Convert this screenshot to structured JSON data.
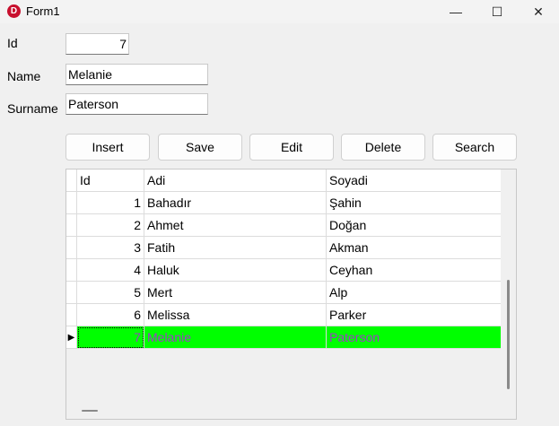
{
  "window": {
    "title": "Form1",
    "icon_letter": "D",
    "minimize_glyph": "—",
    "maximize_glyph": "☐",
    "close_glyph": "✕"
  },
  "form": {
    "id_label": "Id",
    "id_value": "7",
    "name_label": "Name",
    "name_value": "Melanie",
    "surname_label": "Surname",
    "surname_value": "Paterson"
  },
  "buttons": {
    "insert": "Insert",
    "save": "Save",
    "edit": "Edit",
    "delete": "Delete",
    "search": "Search"
  },
  "grid": {
    "columns": [
      "Id",
      "Adi",
      "Soyadi"
    ],
    "rows": [
      {
        "id": "1",
        "adi": "Bahadır",
        "soyadi": "Şahin"
      },
      {
        "id": "2",
        "adi": "Ahmet",
        "soyadi": "Doğan"
      },
      {
        "id": "3",
        "adi": "Fatih",
        "soyadi": "Akman"
      },
      {
        "id": "4",
        "adi": "Haluk",
        "soyadi": "Ceyhan"
      },
      {
        "id": "5",
        "adi": "Mert",
        "soyadi": "Alp"
      },
      {
        "id": "6",
        "adi": "Melissa",
        "soyadi": "Parker"
      },
      {
        "id": "7",
        "adi": "Melanie",
        "soyadi": "Paterson"
      }
    ],
    "selected_row_indicator": "▶",
    "selected_row_bg": "#00ff00",
    "selected_row_fg": "#9b3ec4"
  }
}
